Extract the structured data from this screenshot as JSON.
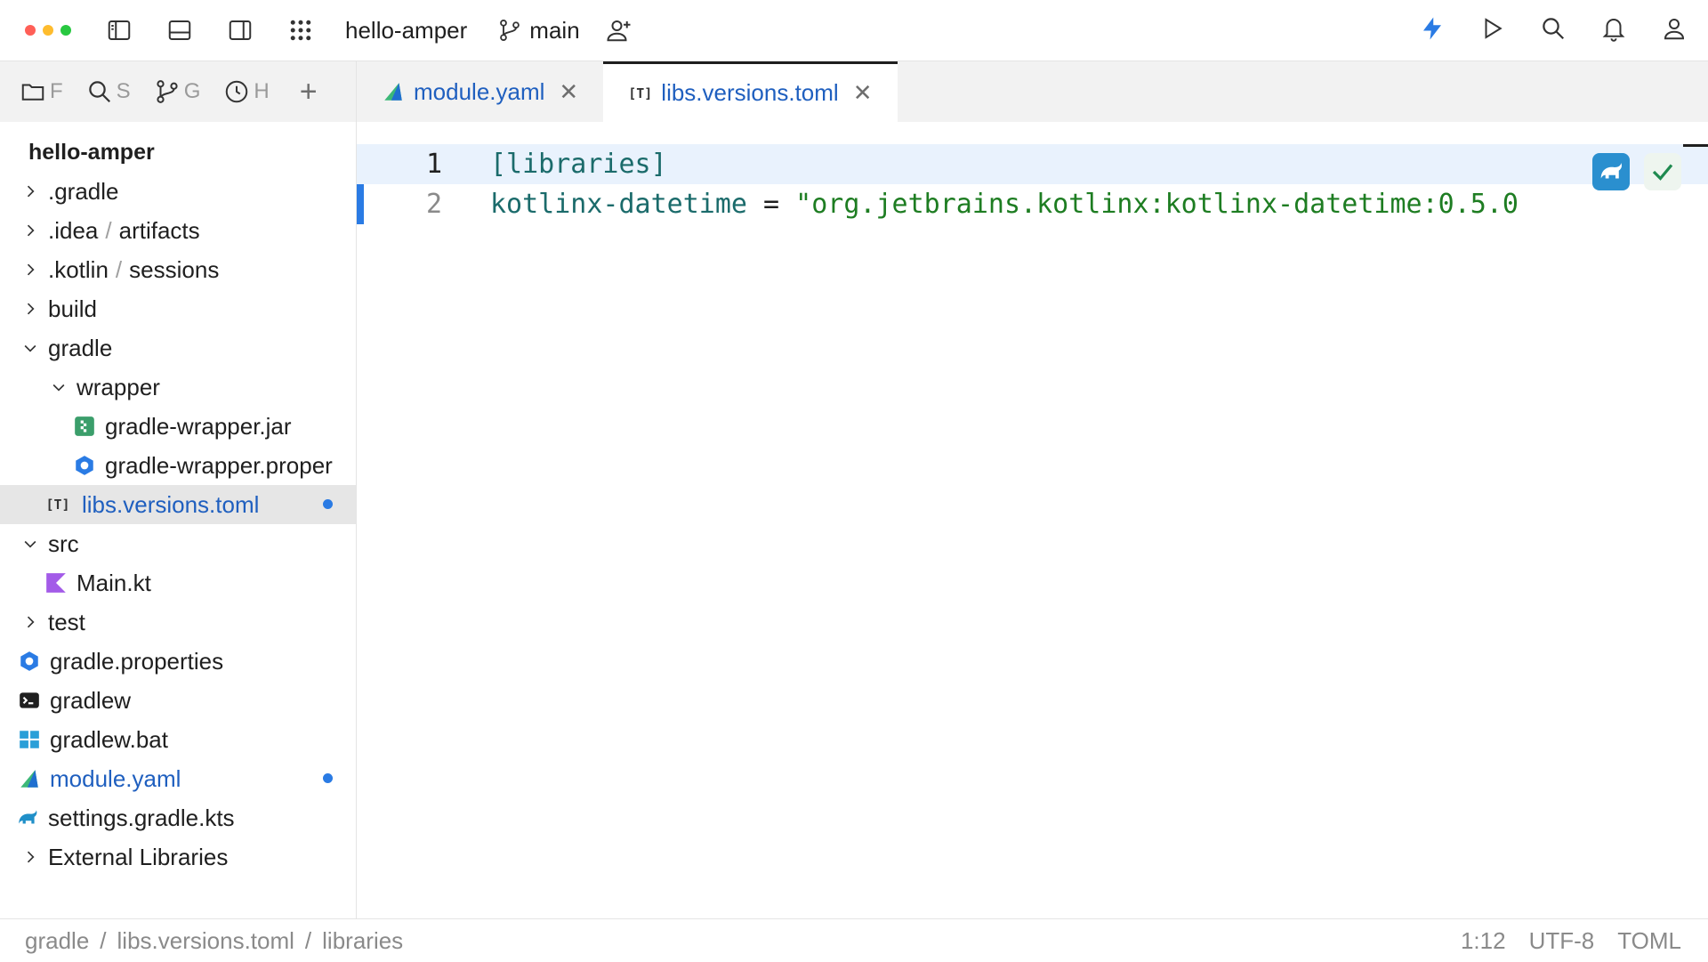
{
  "window": {
    "project_name": "hello-amper",
    "branch": "main",
    "traffic_colors": [
      "#ff5f57",
      "#febc2e",
      "#28c840"
    ]
  },
  "toolbar": {
    "left_icons": [
      "sidebar-left-icon",
      "panel-bottom-icon",
      "sidebar-right-icon",
      "grid-icon"
    ],
    "right_icons": [
      "lightning-icon",
      "run-icon",
      "search-icon",
      "bell-icon",
      "user-icon"
    ],
    "accent": "#2a7be4"
  },
  "side_tabs": [
    {
      "icon": "folder-icon",
      "label": "F"
    },
    {
      "icon": "search-icon",
      "label": "S"
    },
    {
      "icon": "git-icon",
      "label": "G"
    },
    {
      "icon": "history-icon",
      "label": "H"
    }
  ],
  "tree": {
    "root": "hello-amper",
    "items": [
      {
        "label": ".gradle",
        "depth": 0,
        "chevron": "right"
      },
      {
        "label": ".idea",
        "sub": "artifacts",
        "depth": 0,
        "chevron": "right"
      },
      {
        "label": ".kotlin",
        "sub": "sessions",
        "depth": 0,
        "chevron": "right"
      },
      {
        "label": "build",
        "depth": 0,
        "chevron": "right"
      },
      {
        "label": "gradle",
        "depth": 0,
        "chevron": "down"
      },
      {
        "label": "wrapper",
        "depth": 1,
        "chevron": "down"
      },
      {
        "label": "gradle-wrapper.jar",
        "depth": 2,
        "icon": "jar-icon"
      },
      {
        "label": "gradle-wrapper.proper",
        "depth": 2,
        "icon": "properties-icon"
      },
      {
        "label": "libs.versions.toml",
        "depth": 1,
        "icon": "toml-icon",
        "selected": true,
        "modified": true
      },
      {
        "label": "src",
        "depth": 0,
        "chevron": "down"
      },
      {
        "label": "Main.kt",
        "depth": 1,
        "icon": "kotlin-icon"
      },
      {
        "label": "test",
        "depth": 0,
        "chevron": "right"
      },
      {
        "label": "gradle.properties",
        "depth": 0,
        "icon": "properties-icon"
      },
      {
        "label": "gradlew",
        "depth": 0,
        "icon": "terminal-icon"
      },
      {
        "label": "gradlew.bat",
        "depth": 0,
        "icon": "windows-icon"
      },
      {
        "label": "module.yaml",
        "depth": 0,
        "icon": "amper-icon",
        "modified": true
      },
      {
        "label": "settings.gradle.kts",
        "depth": 0,
        "icon": "gradle-elephant-icon"
      },
      {
        "label": "External Libraries",
        "depth": 0,
        "chevron": "right"
      }
    ]
  },
  "editor_tabs": [
    {
      "label": "module.yaml",
      "icon": "amper-icon",
      "active": false
    },
    {
      "label": "libs.versions.toml",
      "icon": "toml-icon",
      "active": true
    }
  ],
  "editor": {
    "lines": [
      {
        "number": "1",
        "text": "[libraries]"
      },
      {
        "number": "2",
        "key": "kotlinx-datetime",
        "eq": " = ",
        "value": "\"org.jetbrains.kotlinx:kotlinx-datetime:0.5.0"
      }
    ]
  },
  "status": {
    "breadcrumbs": [
      "gradle",
      "/",
      "libs.versions.toml",
      "/",
      "libraries"
    ],
    "position": "1:12",
    "encoding": "UTF-8",
    "language": "TOML"
  }
}
